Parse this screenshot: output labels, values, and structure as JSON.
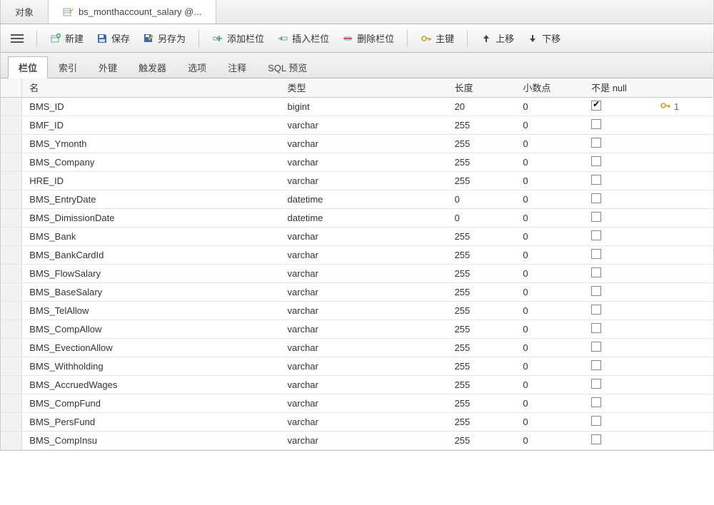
{
  "topTabs": {
    "objects": "对象",
    "tableTab": "bs_monthaccount_salary @..."
  },
  "toolbar": {
    "new": "新建",
    "save": "保存",
    "saveAs": "另存为",
    "addField": "添加栏位",
    "insertField": "插入栏位",
    "deleteField": "删除栏位",
    "primaryKey": "主键",
    "moveUp": "上移",
    "moveDown": "下移"
  },
  "subTabs": {
    "fields": "栏位",
    "indexes": "索引",
    "foreignKeys": "外键",
    "triggers": "触发器",
    "options": "选项",
    "comment": "注释",
    "sqlPreview": "SQL 预览"
  },
  "columns": {
    "name": "名",
    "type": "类型",
    "length": "长度",
    "decimals": "小数点",
    "notNull": "不是 null"
  },
  "rows": [
    {
      "name": "BMS_ID",
      "type": "bigint",
      "len": "20",
      "dec": "0",
      "notnull": true,
      "pk": "1"
    },
    {
      "name": "BMF_ID",
      "type": "varchar",
      "len": "255",
      "dec": "0",
      "notnull": false,
      "pk": ""
    },
    {
      "name": "BMS_Ymonth",
      "type": "varchar",
      "len": "255",
      "dec": "0",
      "notnull": false,
      "pk": ""
    },
    {
      "name": "BMS_Company",
      "type": "varchar",
      "len": "255",
      "dec": "0",
      "notnull": false,
      "pk": ""
    },
    {
      "name": "HRE_ID",
      "type": "varchar",
      "len": "255",
      "dec": "0",
      "notnull": false,
      "pk": ""
    },
    {
      "name": "BMS_EntryDate",
      "type": "datetime",
      "len": "0",
      "dec": "0",
      "notnull": false,
      "pk": ""
    },
    {
      "name": "BMS_DimissionDate",
      "type": "datetime",
      "len": "0",
      "dec": "0",
      "notnull": false,
      "pk": ""
    },
    {
      "name": "BMS_Bank",
      "type": "varchar",
      "len": "255",
      "dec": "0",
      "notnull": false,
      "pk": ""
    },
    {
      "name": "BMS_BankCardId",
      "type": "varchar",
      "len": "255",
      "dec": "0",
      "notnull": false,
      "pk": ""
    },
    {
      "name": "BMS_FlowSalary",
      "type": "varchar",
      "len": "255",
      "dec": "0",
      "notnull": false,
      "pk": ""
    },
    {
      "name": "BMS_BaseSalary",
      "type": "varchar",
      "len": "255",
      "dec": "0",
      "notnull": false,
      "pk": ""
    },
    {
      "name": "BMS_TelAllow",
      "type": "varchar",
      "len": "255",
      "dec": "0",
      "notnull": false,
      "pk": ""
    },
    {
      "name": "BMS_CompAllow",
      "type": "varchar",
      "len": "255",
      "dec": "0",
      "notnull": false,
      "pk": ""
    },
    {
      "name": "BMS_EvectionAllow",
      "type": "varchar",
      "len": "255",
      "dec": "0",
      "notnull": false,
      "pk": ""
    },
    {
      "name": "BMS_Withholding",
      "type": "varchar",
      "len": "255",
      "dec": "0",
      "notnull": false,
      "pk": ""
    },
    {
      "name": "BMS_AccruedWages",
      "type": "varchar",
      "len": "255",
      "dec": "0",
      "notnull": false,
      "pk": ""
    },
    {
      "name": "BMS_CompFund",
      "type": "varchar",
      "len": "255",
      "dec": "0",
      "notnull": false,
      "pk": ""
    },
    {
      "name": "BMS_PersFund",
      "type": "varchar",
      "len": "255",
      "dec": "0",
      "notnull": false,
      "pk": ""
    },
    {
      "name": "BMS_CompInsu",
      "type": "varchar",
      "len": "255",
      "dec": "0",
      "notnull": false,
      "pk": ""
    }
  ]
}
